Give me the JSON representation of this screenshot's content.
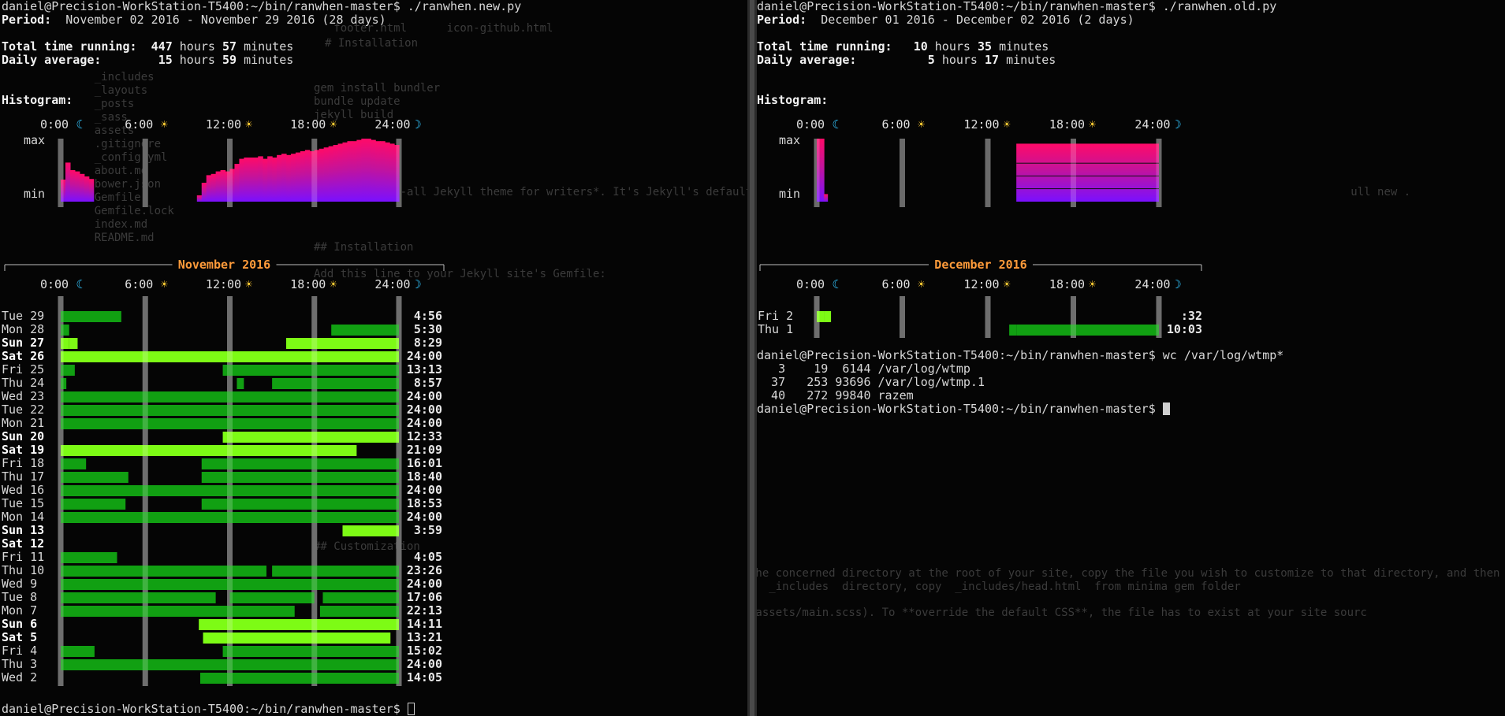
{
  "left": {
    "prompt": "daniel@Precision-WorkStation-T5400:~/bin/ranwhen-master$",
    "command": "./ranwhen.new.py",
    "period_label": "Period:",
    "period_value": "November 02 2016 - November 29 2016 (28 days)",
    "total_label": "Total time running:",
    "total_hours": "447",
    "total_minutes": "57",
    "daily_label": "Daily average:",
    "daily_hours": "15",
    "daily_minutes": "59",
    "hours_word": "hours",
    "minutes_word": "minutes",
    "histogram_label": "Histogram:",
    "max_label": "max",
    "min_label": "min",
    "month_title": "November 2016",
    "histogram": [
      0.35,
      0.62,
      0.5,
      0.48,
      0.44,
      0.4,
      0.36,
      0,
      0,
      0,
      0,
      0,
      0,
      0,
      0,
      0,
      0,
      0,
      0,
      0,
      0,
      0,
      0,
      0,
      0,
      0,
      0,
      0,
      0,
      0.1,
      0.3,
      0.42,
      0.44,
      0.48,
      0.5,
      0.48,
      0.52,
      0.6,
      0.68,
      0.7,
      0.7,
      0.7,
      0.72,
      0.68,
      0.72,
      0.7,
      0.74,
      0.76,
      0.74,
      0.76,
      0.78,
      0.8,
      0.82,
      0.8,
      0.82,
      0.84,
      0.86,
      0.88,
      0.9,
      0.92,
      0.94,
      0.96,
      0.96,
      0.98,
      1.0,
      1.0,
      0.98,
      0.96,
      0.96,
      0.94,
      0.92,
      0.9
    ],
    "days": [
      {
        "dow": "Tue",
        "day": "29",
        "bold": false,
        "total": "4:56",
        "bright": false,
        "segments": [
          [
            0,
            4.3
          ]
        ]
      },
      {
        "dow": "Mon",
        "day": "28",
        "bold": false,
        "total": "5:30",
        "bright": false,
        "segments": [
          [
            0,
            0.6
          ],
          [
            19.2,
            24
          ]
        ]
      },
      {
        "dow": "Sun",
        "day": "27",
        "bold": true,
        "total": "8:29",
        "bright": true,
        "segments": [
          [
            0,
            0.6
          ],
          [
            0.6,
            1.2
          ],
          [
            16,
            24
          ]
        ]
      },
      {
        "dow": "Sat",
        "day": "26",
        "bold": true,
        "total": "24:00",
        "bright": true,
        "segments": [
          [
            0,
            24
          ]
        ]
      },
      {
        "dow": "Fri",
        "day": "25",
        "bold": false,
        "total": "13:13",
        "bright": false,
        "segments": [
          [
            0,
            1
          ],
          [
            11.5,
            24
          ]
        ]
      },
      {
        "dow": "Thu",
        "day": "24",
        "bold": false,
        "total": "8:57",
        "bright": false,
        "segments": [
          [
            0,
            0.4
          ],
          [
            12.5,
            13
          ],
          [
            15,
            24
          ]
        ]
      },
      {
        "dow": "Wed",
        "day": "23",
        "bold": false,
        "total": "24:00",
        "bright": false,
        "segments": [
          [
            0,
            24
          ]
        ]
      },
      {
        "dow": "Tue",
        "day": "22",
        "bold": false,
        "total": "24:00",
        "bright": false,
        "segments": [
          [
            0,
            24
          ]
        ]
      },
      {
        "dow": "Mon",
        "day": "21",
        "bold": false,
        "total": "24:00",
        "bright": false,
        "segments": [
          [
            0,
            24
          ]
        ]
      },
      {
        "dow": "Sun",
        "day": "20",
        "bold": true,
        "total": "12:33",
        "bright": true,
        "segments": [
          [
            11.5,
            24
          ]
        ]
      },
      {
        "dow": "Sat",
        "day": "19",
        "bold": true,
        "total": "21:09",
        "bright": true,
        "segments": [
          [
            0,
            21
          ]
        ]
      },
      {
        "dow": "Fri",
        "day": "18",
        "bold": false,
        "total": "16:01",
        "bright": false,
        "segments": [
          [
            0,
            1.8
          ],
          [
            10,
            24
          ]
        ]
      },
      {
        "dow": "Thu",
        "day": "17",
        "bold": false,
        "total": "18:40",
        "bright": false,
        "segments": [
          [
            0,
            4.8
          ],
          [
            10,
            24
          ]
        ]
      },
      {
        "dow": "Wed",
        "day": "16",
        "bold": false,
        "total": "24:00",
        "bright": false,
        "segments": [
          [
            0,
            24
          ]
        ]
      },
      {
        "dow": "Tue",
        "day": "15",
        "bold": false,
        "total": "18:53",
        "bright": false,
        "segments": [
          [
            0,
            4.6
          ],
          [
            10,
            24
          ]
        ]
      },
      {
        "dow": "Mon",
        "day": "14",
        "bold": false,
        "total": "24:00",
        "bright": false,
        "segments": [
          [
            0,
            24
          ]
        ]
      },
      {
        "dow": "Sun",
        "day": "13",
        "bold": true,
        "total": "3:59",
        "bright": true,
        "segments": [
          [
            20,
            24
          ]
        ]
      },
      {
        "dow": "Sat",
        "day": "12",
        "bold": true,
        "total": "",
        "bright": false,
        "segments": []
      },
      {
        "dow": "Fri",
        "day": "11",
        "bold": false,
        "total": "4:05",
        "bright": false,
        "segments": [
          [
            0,
            4
          ]
        ]
      },
      {
        "dow": "Thu",
        "day": "10",
        "bold": false,
        "total": "23:26",
        "bright": false,
        "segments": [
          [
            0,
            14.6
          ],
          [
            15,
            24
          ]
        ]
      },
      {
        "dow": "Wed",
        "day": "9",
        "bold": false,
        "total": "24:00",
        "bright": false,
        "segments": [
          [
            0,
            24
          ]
        ]
      },
      {
        "dow": "Tue",
        "day": "8",
        "bold": false,
        "total": "17:06",
        "bright": false,
        "segments": [
          [
            0,
            11
          ],
          [
            12,
            18
          ],
          [
            18.6,
            24
          ]
        ]
      },
      {
        "dow": "Mon",
        "day": "7",
        "bold": false,
        "total": "22:13",
        "bright": false,
        "segments": [
          [
            0,
            16.6
          ],
          [
            18.4,
            24
          ]
        ]
      },
      {
        "dow": "Sun",
        "day": "6",
        "bold": true,
        "total": "14:11",
        "bright": true,
        "segments": [
          [
            9.8,
            24
          ]
        ]
      },
      {
        "dow": "Sat",
        "day": "5",
        "bold": true,
        "total": "13:21",
        "bright": true,
        "segments": [
          [
            10.1,
            23.4
          ]
        ]
      },
      {
        "dow": "Fri",
        "day": "4",
        "bold": false,
        "total": "15:02",
        "bright": false,
        "segments": [
          [
            0,
            2.4
          ],
          [
            11.5,
            24
          ]
        ]
      },
      {
        "dow": "Thu",
        "day": "3",
        "bold": false,
        "total": "24:00",
        "bright": false,
        "segments": [
          [
            0,
            24
          ]
        ]
      },
      {
        "dow": "Wed",
        "day": "2",
        "bold": false,
        "total": "14:05",
        "bright": false,
        "segments": [
          [
            9.9,
            24
          ]
        ]
      }
    ],
    "final_prompt": "daniel@Precision-WorkStation-T5400:~/bin/ranwhen-master$"
  },
  "right": {
    "prompt": "daniel@Precision-WorkStation-T5400:~/bin/ranwhen-master$",
    "command": "./ranwhen.old.py",
    "period_label": "Period:",
    "period_value": "December 01 2016 - December 02 2016 (2 days)",
    "total_label": "Total time running:",
    "total_hours": "10",
    "total_minutes": "35",
    "daily_label": "Daily average:",
    "daily_hours": "5",
    "daily_minutes": "17",
    "hours_word": "hours",
    "minutes_word": "minutes",
    "histogram_label": "Histogram:",
    "max_label": "max",
    "min_label": "min",
    "month_title": "December 2016",
    "histogram": [
      1.0,
      1.0,
      0.12,
      0,
      0,
      0,
      0,
      0,
      0,
      0,
      0,
      0,
      0,
      0,
      0,
      0,
      0,
      0,
      0,
      0,
      0,
      0,
      0,
      0,
      0,
      0,
      0,
      0,
      0,
      0,
      0,
      0,
      0,
      0,
      0,
      0,
      0,
      0,
      0,
      0,
      0,
      0,
      0,
      0,
      0,
      0,
      0,
      0,
      0,
      0,
      0,
      0,
      0,
      0,
      0,
      0,
      0,
      0,
      0,
      0,
      0,
      0,
      0,
      0,
      0,
      0,
      0,
      0,
      0,
      0,
      0,
      0,
      0,
      0,
      0,
      0,
      0,
      0,
      0,
      0,
      0,
      0,
      0,
      0,
      0,
      0,
      0,
      0,
      0,
      0,
      0,
      0,
      0,
      0,
      0,
      0
    ],
    "histogram_block": {
      "from": 14,
      "to": 24
    },
    "days": [
      {
        "dow": "Fri",
        "day": "2",
        "bold": false,
        "total": ":32",
        "bright": true,
        "segments": [
          [
            0,
            0.5
          ],
          [
            0.5,
            1.0
          ]
        ]
      },
      {
        "dow": "Thu",
        "day": "1",
        "bold": false,
        "total": "10:03",
        "bright": false,
        "segments": [
          [
            13.5,
            14
          ],
          [
            14,
            24
          ]
        ]
      }
    ],
    "wc_command": "wc /var/log/wtmp*",
    "wc_rows": [
      {
        "lines": "3",
        "words": "19",
        "bytes": "6144",
        "file": "/var/log/wtmp"
      },
      {
        "lines": "37",
        "words": "253",
        "bytes": "93696",
        "file": "/var/log/wtmp.1"
      },
      {
        "lines": "40",
        "words": "272",
        "bytes": "99840",
        "file": "razem"
      }
    ],
    "final_prompt": "daniel@Precision-WorkStation-T5400:~/bin/ranwhen-master$"
  },
  "axis": {
    "labels": [
      "0:00",
      "6:00",
      "12:00",
      "18:00",
      "24:00"
    ],
    "icons": [
      "☾",
      "☀",
      "☀",
      "☀",
      "☽"
    ]
  },
  "colors": {
    "green": "#11a012",
    "green_bright": "#7dfb15",
    "hist_top": "#ff0a68",
    "hist_bottom": "#7a10ff",
    "track": "#4a4a4a",
    "month": "#ff9b3a"
  }
}
